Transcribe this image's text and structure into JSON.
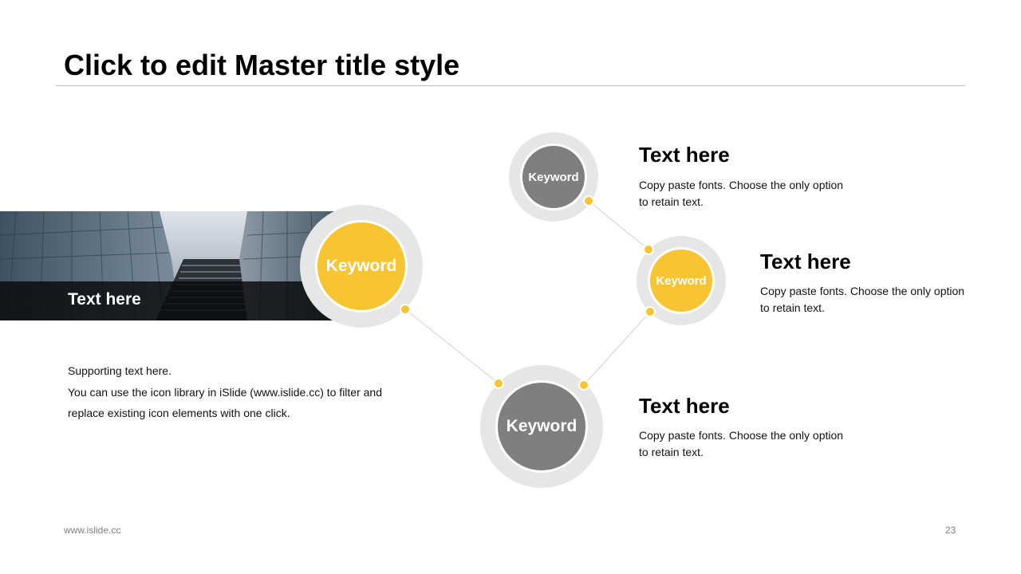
{
  "title": "Click to edit Master title style",
  "banner": {
    "label": "Text here"
  },
  "nodes": [
    {
      "keyword": "Keyword",
      "color": "#f7c531"
    },
    {
      "keyword": "Keyword",
      "color": "#7f7f7f"
    },
    {
      "keyword": "Keyword",
      "color": "#f7c531"
    },
    {
      "keyword": "Keyword",
      "color": "#7f7f7f"
    }
  ],
  "items": [
    {
      "heading": "Text here",
      "body": "Copy paste fonts. Choose the only option to retain text."
    },
    {
      "heading": "Text here",
      "body": "Copy paste fonts. Choose the only option to retain text."
    },
    {
      "heading": "Text here",
      "body": "Copy paste fonts. Choose the only option to retain text."
    }
  ],
  "support": {
    "lines": [
      "Supporting text here.",
      "You can use the icon library in iSlide  (www.islide.cc)  to filter and",
      "replace existing icon elements with one click."
    ]
  },
  "footer": {
    "url": "www.islide.cc",
    "page": "23"
  },
  "colors": {
    "accent": "#f7c531",
    "node_gray": "#7f7f7f",
    "ring": "#e6e6e6",
    "connector": "#d0d0d0"
  }
}
